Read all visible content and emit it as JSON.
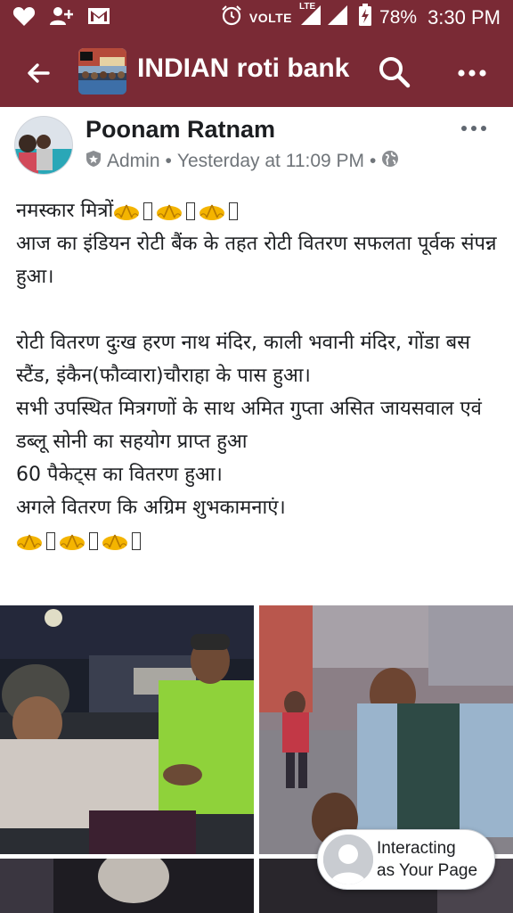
{
  "status_bar": {
    "network_label": "VOLTE",
    "lte_label": "LTE",
    "battery_percent": "78%",
    "time": "3:30 PM",
    "icons": [
      "heart-icon",
      "add-person-icon",
      "gmail-icon",
      "alarm-icon",
      "signal-icon",
      "battery-charging-icon"
    ]
  },
  "app_bar": {
    "title": "INDIAN roti bank",
    "icons": [
      "back-arrow-icon",
      "search-icon",
      "more-icon"
    ],
    "color": "#7a2a35"
  },
  "post": {
    "author": "Poonam Ratnam",
    "role": "Admin",
    "separator": "•",
    "timestamp": "Yesterday at 11:09 PM",
    "audience_icon": "globe-icon",
    "lines": {
      "greeting": "नमस्कार मित्रों",
      "p1": "आज का इंडियन रोटी बैंक के तहत रोटी वितरण सफलता पूर्वक संपन्न हुआ।",
      "p2": "रोटी वितरण दुःख हरण नाथ मंदिर, काली भवानी मंदिर, गोंडा बस स्टैंड, इंकैन(फौव्वारा)चौराहा के पास हुआ।",
      "p3": "सभी उपस्थित मित्रगणों  के साथ अमित गुप्ता असित जायसवाल एवं डब्लू सोनी का सहयोग प्राप्त हुआ",
      "p4": "60 पैकेट्स का वितरण हुआ।",
      "p5": "अगले वितरण कि अग्रिम शुभकामनाएं।"
    },
    "emoji": "folded-hands-icon"
  },
  "interacting_pill": {
    "line1": "Interacting",
    "line2": "as Your Page"
  }
}
